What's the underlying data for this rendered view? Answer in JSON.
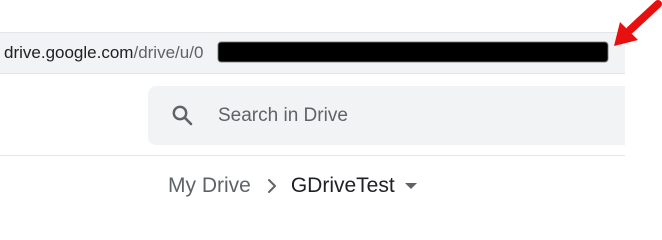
{
  "address_bar": {
    "domain": "drive.google.com",
    "path": "/drive/u/0"
  },
  "search": {
    "placeholder": "Search in Drive",
    "icon": "search-icon"
  },
  "breadcrumb": {
    "root_label": "My Drive",
    "separator_icon": "chevron-right-icon",
    "current_label": "GDriveTest",
    "dropdown_icon": "caret-down-icon"
  },
  "colors": {
    "arrow": "#e8100e",
    "search_bg": "#f1f3f4"
  }
}
